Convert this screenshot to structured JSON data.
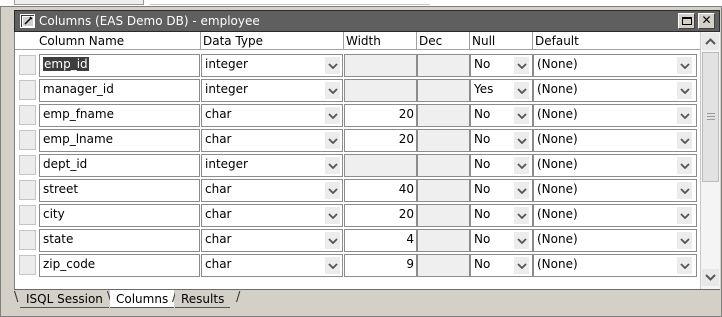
{
  "window": {
    "title": "Columns (EAS Demo DB) - employee"
  },
  "grid": {
    "headers": {
      "column_name": "Column Name",
      "data_type": "Data Type",
      "width": "Width",
      "dec": "Dec",
      "null": "Null",
      "default": "Default"
    },
    "rows": [
      {
        "name": "emp_id",
        "type": "integer",
        "width": "",
        "dec": "",
        "null": "No",
        "default": "(None)"
      },
      {
        "name": "manager_id",
        "type": "integer",
        "width": "",
        "dec": "",
        "null": "Yes",
        "default": "(None)"
      },
      {
        "name": "emp_fname",
        "type": "char",
        "width": "20",
        "dec": "",
        "null": "No",
        "default": "(None)"
      },
      {
        "name": "emp_lname",
        "type": "char",
        "width": "20",
        "dec": "",
        "null": "No",
        "default": "(None)"
      },
      {
        "name": "dept_id",
        "type": "integer",
        "width": "",
        "dec": "",
        "null": "No",
        "default": "(None)"
      },
      {
        "name": "street",
        "type": "char",
        "width": "40",
        "dec": "",
        "null": "No",
        "default": "(None)"
      },
      {
        "name": "city",
        "type": "char",
        "width": "20",
        "dec": "",
        "null": "No",
        "default": "(None)"
      },
      {
        "name": "state",
        "type": "char",
        "width": "4",
        "dec": "",
        "null": "No",
        "default": "(None)"
      },
      {
        "name": "zip_code",
        "type": "char",
        "width": "9",
        "dec": "",
        "null": "No",
        "default": "(None)"
      }
    ],
    "selected_row": 0,
    "grey_width_rows": [
      0,
      1,
      4
    ]
  },
  "tabs": [
    {
      "label": "ISQL Session",
      "active": false
    },
    {
      "label": "Columns",
      "active": true
    },
    {
      "label": "Results",
      "active": false
    }
  ],
  "icons": {
    "window": "window-icon",
    "restore": "restore-icon",
    "close": "close-icon",
    "dropdown": "chevron-down-icon",
    "scroll_up": "scroll-up-icon",
    "scroll_down": "scroll-down-icon"
  },
  "colors": {
    "titlebar": "#5f5f5f",
    "selection": "#3d3d3d",
    "chrome": "#d4d0c8"
  }
}
